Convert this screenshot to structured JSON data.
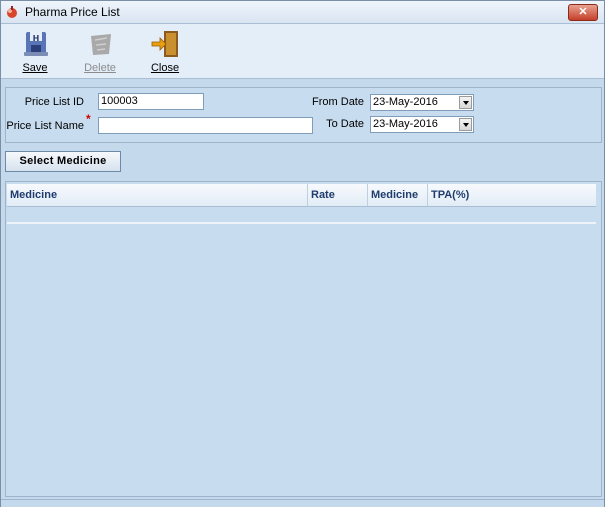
{
  "window": {
    "title": "Pharma Price List",
    "close_label": "✕"
  },
  "toolbar": {
    "save_label": "Save",
    "delete_label": "Delete",
    "close_label": "Close"
  },
  "form": {
    "price_list_id_label": "Price List ID",
    "price_list_id_value": "100003",
    "price_list_name_label": "Price List Name",
    "price_list_name_value": "",
    "required_mark": "*",
    "from_date_label": "From Date",
    "from_date_value": "23-May-2016",
    "to_date_label": "To Date",
    "to_date_value": "23-May-2016"
  },
  "select_medicine_label": "Select Medicine",
  "grid": {
    "columns": [
      "Medicine",
      "Rate",
      "Medicine",
      "TPA(%)"
    ]
  },
  "colors": {
    "accent": "#1e3c6e",
    "background": "#c5d9ec",
    "required": "#d00000"
  },
  "icons": {
    "app": "pharma-icon",
    "save": "disk-icon",
    "delete": "delete-icon",
    "close": "exit-door-icon"
  }
}
